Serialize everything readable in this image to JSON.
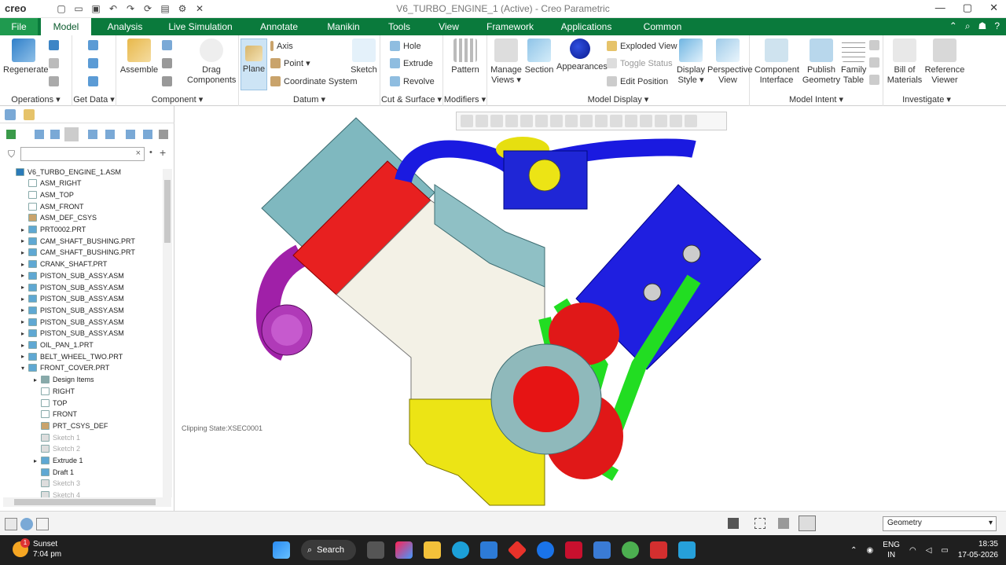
{
  "titlebar": {
    "logo": "creo",
    "title": "V6_TURBO_ENGINE_1 (Active) - Creo Parametric",
    "quick_access": [
      {
        "icon": "new-icon",
        "glyph": "▢"
      },
      {
        "icon": "open-icon",
        "glyph": "▭"
      },
      {
        "icon": "save-icon",
        "glyph": "▣"
      },
      {
        "icon": "undo-icon",
        "glyph": "↶"
      },
      {
        "icon": "redo-icon",
        "glyph": "↷"
      },
      {
        "icon": "regenerate-icon",
        "glyph": "⟳"
      },
      {
        "icon": "windows-icon",
        "glyph": "▤"
      },
      {
        "icon": "settings-icon",
        "glyph": "⚙"
      },
      {
        "icon": "close-window-icon",
        "glyph": "✕"
      }
    ],
    "window_controls": [
      "—",
      "▢",
      "✕"
    ]
  },
  "menubar": {
    "tabs": [
      "File",
      "Model",
      "Analysis",
      "Live Simulation",
      "Annotate",
      "Manikin",
      "Tools",
      "View",
      "Framework",
      "Applications",
      "Common"
    ],
    "active": "Model",
    "right_icons": [
      "⌃",
      "⌕",
      "☗",
      "?"
    ]
  },
  "ribbon": {
    "operations": {
      "regenerate": "Regenerate",
      "label": "Operations ▾"
    },
    "get_data": {
      "label": "Get Data ▾"
    },
    "component": {
      "assemble": "Assemble",
      "drag": "Drag Components",
      "label": "Component ▾"
    },
    "datum": {
      "plane": "Plane",
      "axis": "Axis",
      "point": "Point ▾",
      "csys": "Coordinate System",
      "sketch": "Sketch",
      "label": "Datum ▾"
    },
    "cut_surface": {
      "hole": "Hole",
      "extrude": "Extrude",
      "revolve": "Revolve",
      "label": "Cut & Surface ▾"
    },
    "modifiers": {
      "pattern": "Pattern",
      "label": "Modifiers ▾"
    },
    "model_display": {
      "manage_views": "Manage Views ▾",
      "section": "Section",
      "appearances": "Appearances",
      "exploded_view": "Exploded View",
      "toggle_status": "Toggle Status",
      "edit_position": "Edit Position",
      "display_style": "Display Style ▾",
      "perspective_view": "Perspective View",
      "label": "Model Display ▾"
    },
    "model_intent": {
      "component_interface": "Component Interface",
      "publish_geometry": "Publish Geometry",
      "family_table": "Family Table",
      "label": "Model Intent ▾"
    },
    "investigate": {
      "bom": "Bill of Materials",
      "reference_viewer": "Reference Viewer",
      "label": "Investigate ▾"
    }
  },
  "tree": {
    "items": [
      {
        "label": "V6_TURBO_ENGINE_1.ASM",
        "indent": 0,
        "expander": "",
        "icon": "#2a7ab8"
      },
      {
        "label": "ASM_RIGHT",
        "indent": 1,
        "expander": "",
        "icon": "#fff"
      },
      {
        "label": "ASM_TOP",
        "indent": 1,
        "expander": "",
        "icon": "#fff"
      },
      {
        "label": "ASM_FRONT",
        "indent": 1,
        "expander": "",
        "icon": "#fff"
      },
      {
        "label": "ASM_DEF_CSYS",
        "indent": 1,
        "expander": "",
        "icon": "#c9a36b"
      },
      {
        "label": "PRT0002.PRT",
        "indent": 1,
        "expander": "▸",
        "icon": "#5fa8d3"
      },
      {
        "label": "CAM_SHAFT_BUSHING.PRT",
        "indent": 1,
        "expander": "▸",
        "icon": "#5fa8d3"
      },
      {
        "label": "CAM_SHAFT_BUSHING.PRT",
        "indent": 1,
        "expander": "▸",
        "icon": "#5fa8d3"
      },
      {
        "label": "CRANK_SHAFT.PRT",
        "indent": 1,
        "expander": "▸",
        "icon": "#5fa8d3"
      },
      {
        "label": "PISTON_SUB_ASSY.ASM",
        "indent": 1,
        "expander": "▸",
        "icon": "#5fa8d3"
      },
      {
        "label": "PISTON_SUB_ASSY.ASM",
        "indent": 1,
        "expander": "▸",
        "icon": "#5fa8d3"
      },
      {
        "label": "PISTON_SUB_ASSY.ASM",
        "indent": 1,
        "expander": "▸",
        "icon": "#5fa8d3"
      },
      {
        "label": "PISTON_SUB_ASSY.ASM",
        "indent": 1,
        "expander": "▸",
        "icon": "#5fa8d3"
      },
      {
        "label": "PISTON_SUB_ASSY.ASM",
        "indent": 1,
        "expander": "▸",
        "icon": "#5fa8d3"
      },
      {
        "label": "PISTON_SUB_ASSY.ASM",
        "indent": 1,
        "expander": "▸",
        "icon": "#5fa8d3"
      },
      {
        "label": "OIL_PAN_1.PRT",
        "indent": 1,
        "expander": "▸",
        "icon": "#5fa8d3"
      },
      {
        "label": "BELT_WHEEL_TWO.PRT",
        "indent": 1,
        "expander": "▸",
        "icon": "#5fa8d3"
      },
      {
        "label": "FRONT_COVER.PRT",
        "indent": 1,
        "expander": "▾",
        "icon": "#5fa8d3"
      },
      {
        "label": "Design Items",
        "indent": 2,
        "expander": "▸",
        "icon": "#8aa"
      },
      {
        "label": "RIGHT",
        "indent": 2,
        "expander": "",
        "icon": "#fff"
      },
      {
        "label": "TOP",
        "indent": 2,
        "expander": "",
        "icon": "#fff"
      },
      {
        "label": "FRONT",
        "indent": 2,
        "expander": "",
        "icon": "#fff"
      },
      {
        "label": "PRT_CSYS_DEF",
        "indent": 2,
        "expander": "",
        "icon": "#c9a36b"
      },
      {
        "label": "Sketch 1",
        "indent": 2,
        "expander": "",
        "icon": "#ddd",
        "gray": true
      },
      {
        "label": "Sketch 2",
        "indent": 2,
        "expander": "",
        "icon": "#ddd",
        "gray": true
      },
      {
        "label": "Extrude 1",
        "indent": 2,
        "expander": "▸",
        "icon": "#5fa8d3"
      },
      {
        "label": "Draft 1",
        "indent": 2,
        "expander": "",
        "icon": "#5fa8d3"
      },
      {
        "label": "Sketch 3",
        "indent": 2,
        "expander": "",
        "icon": "#ddd",
        "gray": true
      },
      {
        "label": "Sketch 4",
        "indent": 2,
        "expander": "",
        "icon": "#ddd",
        "gray": true
      }
    ]
  },
  "viewport": {
    "clipping_state": "Clipping State:XSEC0001"
  },
  "statusbar": {
    "selection_filter": "Geometry"
  },
  "taskbar": {
    "weather_badge": "1",
    "weather_title": "Sunset",
    "weather_time": "7:04 pm",
    "search": "Search",
    "lang_1": "ENG",
    "lang_2": "IN",
    "time": "18:35",
    "date": "17-05-2026"
  }
}
